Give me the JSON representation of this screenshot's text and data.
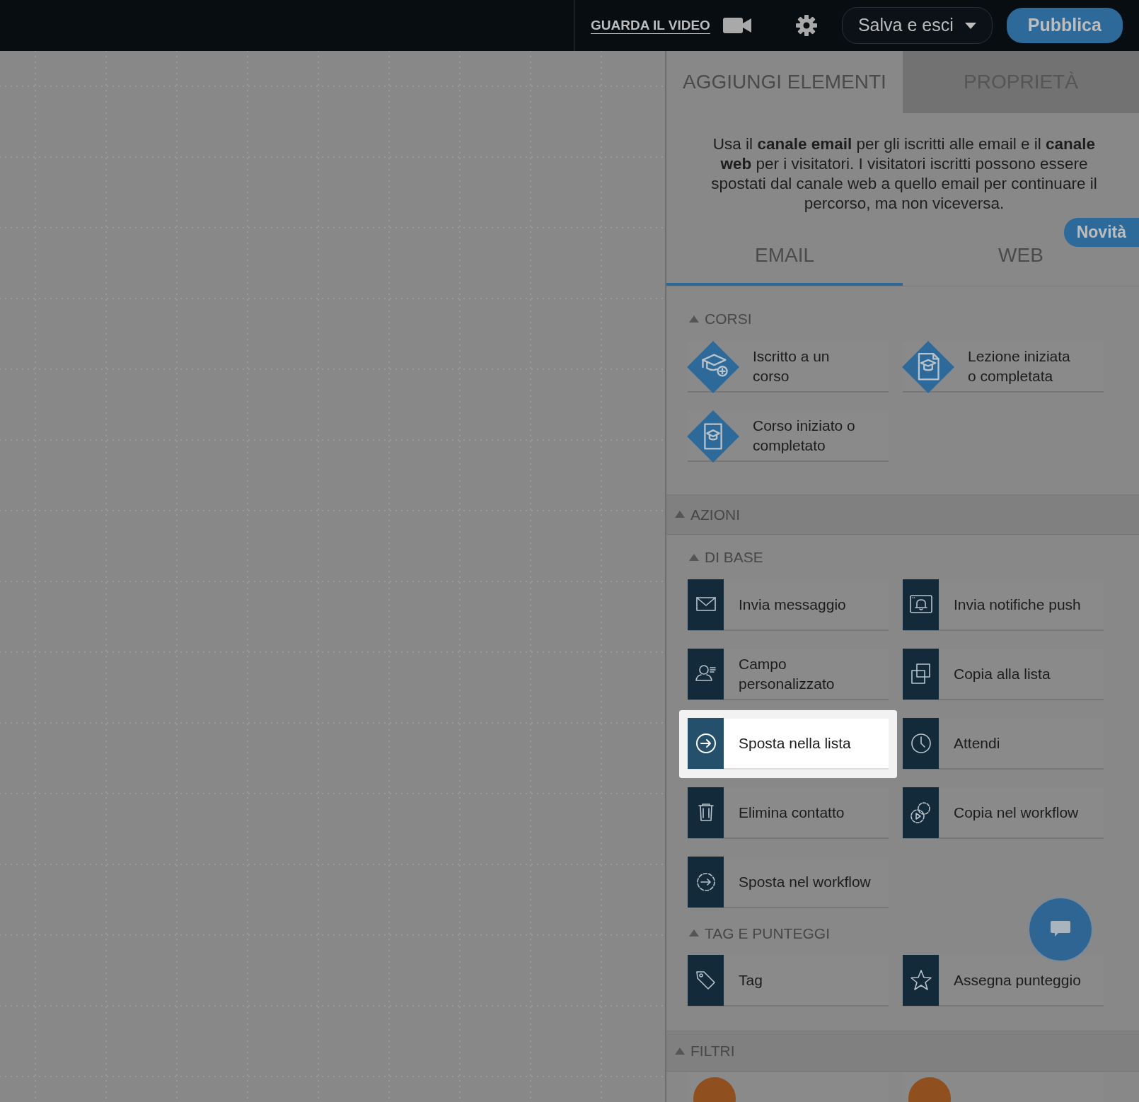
{
  "topbar": {
    "video_link": "GUARDA IL VIDEO",
    "save_menu": "Salva e esci",
    "publish_button": "Pubblica"
  },
  "panel_tabs": [
    {
      "label": "AGGIUNGI ELEMENTI",
      "selected": true
    },
    {
      "label": "PROPRIETÀ",
      "selected": false
    }
  ],
  "description": "Usa il **canale email** per gli iscritti alle email e il **canale web** per i visitatori. I visitatori iscritti possono essere spostati dal canale web a quello email per continuare il percorso, ma non viceversa.",
  "badge": "Novità",
  "channel_tabs": [
    {
      "label": "EMAIL",
      "selected": true
    },
    {
      "label": "WEB",
      "selected": false
    }
  ],
  "sections": [
    {
      "title": "CORSI",
      "kind": "subsection",
      "expanded": true,
      "items": [
        {
          "label": "Iscritto a un corso",
          "kind": "enroll",
          "selected": false
        },
        {
          "label": "Lezione iniziata o completata",
          "kind": "lesson",
          "selected": false
        },
        {
          "label": "Corso iniziato o completato",
          "kind": "course",
          "selected": false
        }
      ]
    },
    {
      "title": "AZIONI",
      "kind": "group",
      "expanded": true,
      "children": [
        {
          "title": "DI BASE",
          "expanded": true,
          "items": [
            {
              "label": "Invia messaggio",
              "kind": "message",
              "selected": false
            },
            {
              "label": "Invia notifiche push",
              "kind": "push",
              "selected": false
            },
            {
              "label": "Campo personalizzato",
              "kind": "field",
              "selected": false
            },
            {
              "label": "Copia alla lista",
              "kind": "copy",
              "selected": false
            },
            {
              "label": "Sposta nella lista",
              "kind": "move",
              "selected": true
            },
            {
              "label": "Attendi",
              "kind": "wait",
              "selected": false
            },
            {
              "label": "Elimina contatto",
              "kind": "delete",
              "selected": false
            },
            {
              "label": "Copia nel workflow",
              "kind": "copyflow",
              "selected": false
            },
            {
              "label": "Sposta nel workflow",
              "kind": "moveflow",
              "selected": false
            }
          ]
        },
        {
          "title": "TAG E PUNTEGGI",
          "expanded": true,
          "items": [
            {
              "label": "Tag",
              "kind": "tag",
              "selected": false
            },
            {
              "label": "Assegna punteggio",
              "kind": "score",
              "selected": false
            }
          ]
        }
      ]
    },
    {
      "title": "FILTRI",
      "kind": "group",
      "expanded": true,
      "items": [
        {
          "kind": "filter",
          "selected": false
        },
        {
          "kind": "filter",
          "selected": false
        }
      ]
    }
  ]
}
